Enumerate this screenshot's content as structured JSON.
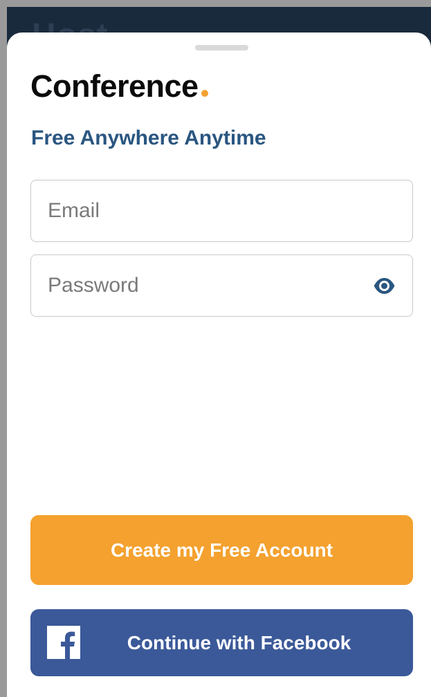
{
  "background": {
    "title_fragment": "Host"
  },
  "brand": {
    "name": "Conference",
    "dot_color": "#f4a12f",
    "tagline": "Free Anywhere Anytime"
  },
  "form": {
    "email_placeholder": "Email",
    "email_value": "",
    "password_placeholder": "Password",
    "password_value": "",
    "password_toggle_icon": "eye-icon"
  },
  "actions": {
    "create_account_label": "Create my Free Account",
    "create_account_color": "#f4a12f",
    "facebook_label": "Continue with Facebook",
    "facebook_color": "#3b5999",
    "facebook_icon": "facebook-icon"
  }
}
